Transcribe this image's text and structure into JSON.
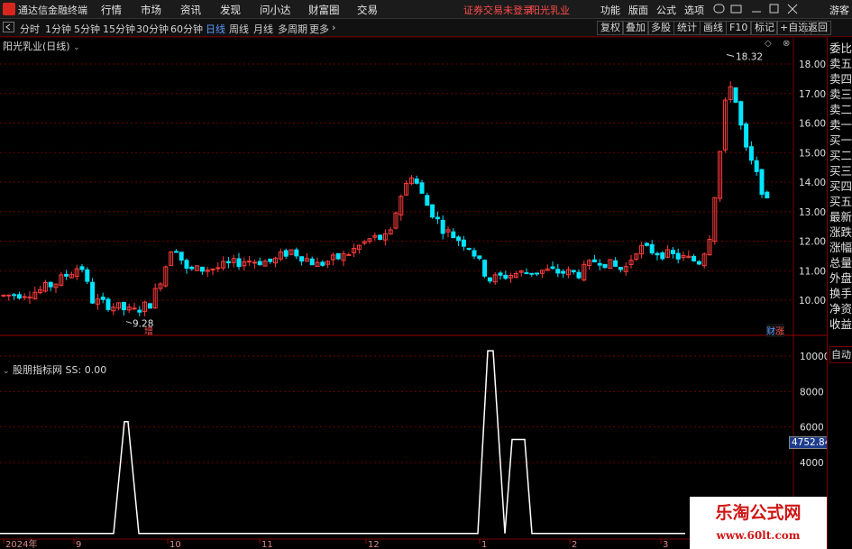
{
  "app": {
    "title": "通达信金融终端",
    "guest": "游客",
    "window_controls": "— ▢ ✕"
  },
  "menu": [
    "行情",
    "市场",
    "资讯",
    "发现",
    "问小达",
    "财富圈",
    "交易"
  ],
  "warning": "证券交易未登录",
  "stock_name": "阳光乳业",
  "right_menu": [
    "功能",
    "版面",
    "公式",
    "选项"
  ],
  "periods": [
    "分时",
    "1分钟",
    "5分钟",
    "15分钟",
    "30分钟",
    "60分钟",
    "日线",
    "周线",
    "月线",
    "多周期",
    "更多"
  ],
  "active_period": "日线",
  "tools": [
    "复权",
    "叠加",
    "多股",
    "统计",
    "画线",
    "F10",
    "标记",
    "+自选",
    "返回"
  ],
  "main_title": "阳光乳业(日线)",
  "indicator_title": "股朋指标网 SS: 0.00",
  "right_panel": [
    "委比",
    "卖五",
    "卖四",
    "卖三",
    "卖二",
    "卖一",
    "买一",
    "买二",
    "买三",
    "买四",
    "买五",
    "最新",
    "涨跌",
    "涨幅",
    "总量",
    "外盘",
    "换手",
    "净资",
    "收益"
  ],
  "auto_label": "自动",
  "badge_zeng": "增",
  "badge_caibao": "财",
  "badge_zhang": "涨",
  "cursor_value": "4752.84",
  "watermark": {
    "line1": "乐淘公式网",
    "line2": "www.60lt.com"
  },
  "colors": {
    "up": "#ff3c3c",
    "down": "#00e5ff",
    "grid": "#6e0000",
    "line": "#ffffff"
  },
  "chart_data": [
    {
      "type": "candlestick",
      "title": "阳光乳业(日线)",
      "y_ticks": [
        10.0,
        11.0,
        12.0,
        13.0,
        14.0,
        15.0,
        16.0,
        17.0,
        18.0
      ],
      "ylim": [
        9.0,
        18.8
      ],
      "annotations": [
        {
          "label": "18.32",
          "value": 18.32
        },
        {
          "label": "9.28",
          "value": 9.28
        }
      ],
      "x_ticks": [
        "2024年",
        "9",
        "10",
        "11",
        "12",
        "1",
        "2",
        "3"
      ]
    },
    {
      "type": "line",
      "title": "股朋指标网",
      "series": [
        {
          "name": "SS"
        }
      ],
      "y_ticks": [
        4000,
        6000,
        8000,
        10000
      ],
      "ylim": [
        0,
        10500
      ],
      "spikes": [
        {
          "peak": 6300
        },
        {
          "peak": 10300
        },
        {
          "peak": 5300
        }
      ]
    }
  ]
}
